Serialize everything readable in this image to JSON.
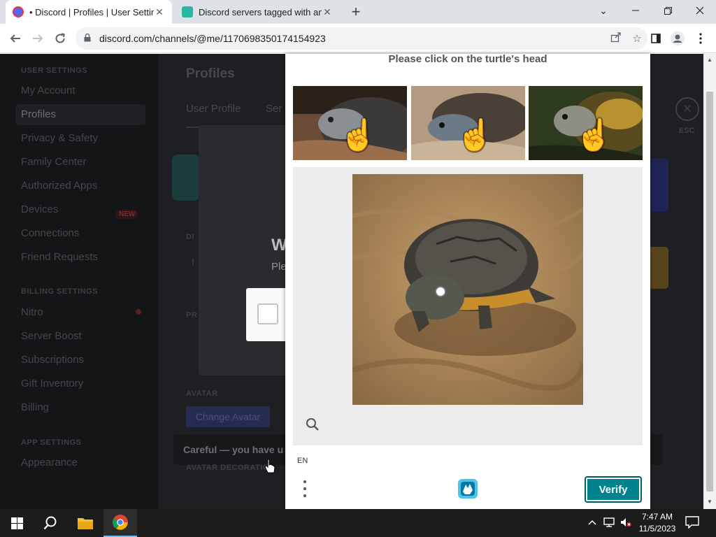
{
  "browser": {
    "tabs": [
      {
        "title": "• Discord | Profiles | User Settings",
        "active": true
      },
      {
        "title": "Discord servers tagged with ana",
        "active": false
      }
    ],
    "url": "discord.com/channels/@me/1170698350174154923"
  },
  "discord": {
    "sidebar": {
      "user_settings_header": "USER SETTINGS",
      "user_items": [
        "My Account",
        "Profiles",
        "Privacy & Safety",
        "Family Center",
        "Authorized Apps",
        "Devices",
        "Connections",
        "Friend Requests"
      ],
      "devices_badge": "NEW",
      "billing_header": "BILLING SETTINGS",
      "billing_items": [
        "Nitro",
        "Server Boost",
        "Subscriptions",
        "Gift Inventory",
        "Billing"
      ],
      "app_header": "APP SETTINGS",
      "app_items": [
        "Appearance"
      ]
    },
    "content": {
      "title": "Profiles",
      "tab_user_profile": "User Profile",
      "tab_server": "Ser",
      "display_label": "DI",
      "display_value": "I",
      "pronouns_label": "PR",
      "avatar_label": "AVATAR",
      "change_avatar": "Change Avatar",
      "careful_text": "Careful — you have u",
      "avatar_decoration_label": "AVATAR DECORATIO",
      "esc_label": "ESC"
    },
    "modal": {
      "title": "W",
      "subtitle": "Ple"
    }
  },
  "captcha": {
    "prompt": "Please click on the turtle's head",
    "language": "EN",
    "verify_label": "Verify",
    "examples": 3,
    "zoom_icon": "magnifier-icon",
    "brand_icon": "hcaptcha-logo"
  },
  "taskbar": {
    "time": "7:47 AM",
    "date": "11/5/2023"
  }
}
